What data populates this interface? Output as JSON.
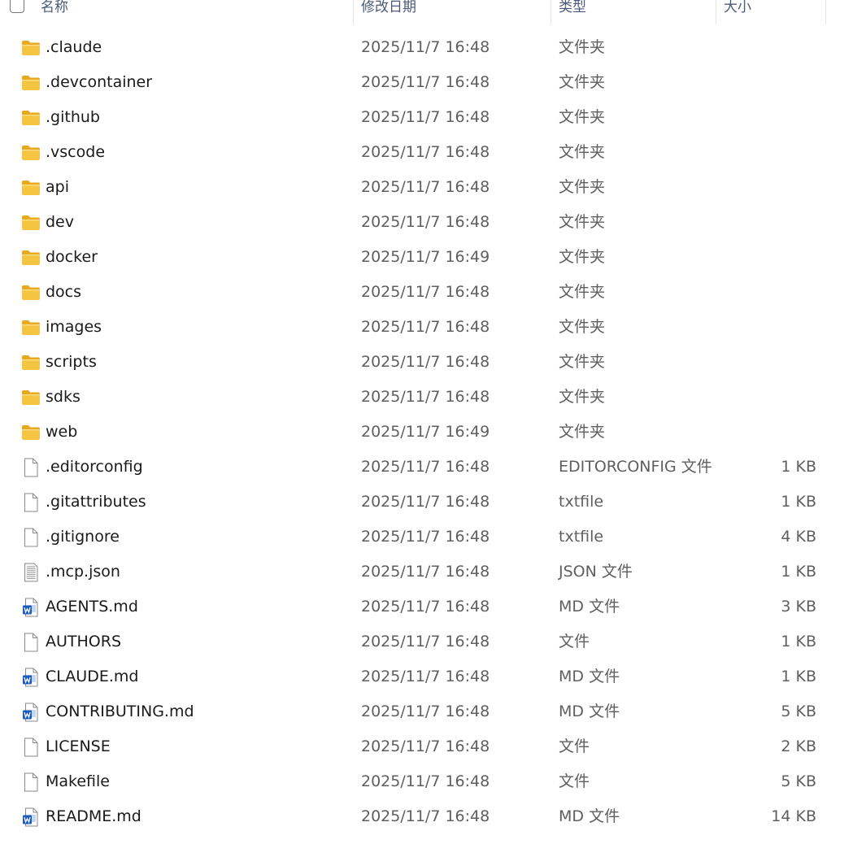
{
  "header": {
    "name": "名称",
    "modified": "修改日期",
    "type": "类型",
    "size": "大小"
  },
  "colors": {
    "folder": "#f5c542",
    "folder_dark": "#e8a91f",
    "word_blue": "#185abd",
    "header_text": "#4a5a78"
  },
  "files": [
    {
      "name": ".claude",
      "modified": "2025/11/7 16:48",
      "type": "文件夹",
      "size": "",
      "icon": "folder-icon"
    },
    {
      "name": ".devcontainer",
      "modified": "2025/11/7 16:48",
      "type": "文件夹",
      "size": "",
      "icon": "folder-icon"
    },
    {
      "name": ".github",
      "modified": "2025/11/7 16:48",
      "type": "文件夹",
      "size": "",
      "icon": "folder-icon"
    },
    {
      "name": ".vscode",
      "modified": "2025/11/7 16:48",
      "type": "文件夹",
      "size": "",
      "icon": "folder-icon"
    },
    {
      "name": "api",
      "modified": "2025/11/7 16:48",
      "type": "文件夹",
      "size": "",
      "icon": "folder-icon"
    },
    {
      "name": "dev",
      "modified": "2025/11/7 16:48",
      "type": "文件夹",
      "size": "",
      "icon": "folder-icon"
    },
    {
      "name": "docker",
      "modified": "2025/11/7 16:49",
      "type": "文件夹",
      "size": "",
      "icon": "folder-icon"
    },
    {
      "name": "docs",
      "modified": "2025/11/7 16:48",
      "type": "文件夹",
      "size": "",
      "icon": "folder-icon"
    },
    {
      "name": "images",
      "modified": "2025/11/7 16:48",
      "type": "文件夹",
      "size": "",
      "icon": "folder-icon"
    },
    {
      "name": "scripts",
      "modified": "2025/11/7 16:48",
      "type": "文件夹",
      "size": "",
      "icon": "folder-icon"
    },
    {
      "name": "sdks",
      "modified": "2025/11/7 16:48",
      "type": "文件夹",
      "size": "",
      "icon": "folder-icon"
    },
    {
      "name": "web",
      "modified": "2025/11/7 16:49",
      "type": "文件夹",
      "size": "",
      "icon": "folder-icon"
    },
    {
      "name": ".editorconfig",
      "modified": "2025/11/7 16:48",
      "type": "EDITORCONFIG 文件",
      "size": "1 KB",
      "icon": "blank-file-icon"
    },
    {
      "name": ".gitattributes",
      "modified": "2025/11/7 16:48",
      "type": "txtfile",
      "size": "1 KB",
      "icon": "blank-file-icon"
    },
    {
      "name": ".gitignore",
      "modified": "2025/11/7 16:48",
      "type": "txtfile",
      "size": "4 KB",
      "icon": "blank-file-icon"
    },
    {
      "name": ".mcp.json",
      "modified": "2025/11/7 16:48",
      "type": "JSON 文件",
      "size": "1 KB",
      "icon": "text-file-icon"
    },
    {
      "name": "AGENTS.md",
      "modified": "2025/11/7 16:48",
      "type": "MD 文件",
      "size": "3 KB",
      "icon": "word-document-icon"
    },
    {
      "name": "AUTHORS",
      "modified": "2025/11/7 16:48",
      "type": "文件",
      "size": "1 KB",
      "icon": "blank-file-icon"
    },
    {
      "name": "CLAUDE.md",
      "modified": "2025/11/7 16:48",
      "type": "MD 文件",
      "size": "1 KB",
      "icon": "word-document-icon"
    },
    {
      "name": "CONTRIBUTING.md",
      "modified": "2025/11/7 16:48",
      "type": "MD 文件",
      "size": "5 KB",
      "icon": "word-document-icon"
    },
    {
      "name": "LICENSE",
      "modified": "2025/11/7 16:48",
      "type": "文件",
      "size": "2 KB",
      "icon": "blank-file-icon"
    },
    {
      "name": "Makefile",
      "modified": "2025/11/7 16:48",
      "type": "文件",
      "size": "5 KB",
      "icon": "blank-file-icon"
    },
    {
      "name": "README.md",
      "modified": "2025/11/7 16:48",
      "type": "MD 文件",
      "size": "14 KB",
      "icon": "word-document-icon"
    }
  ]
}
